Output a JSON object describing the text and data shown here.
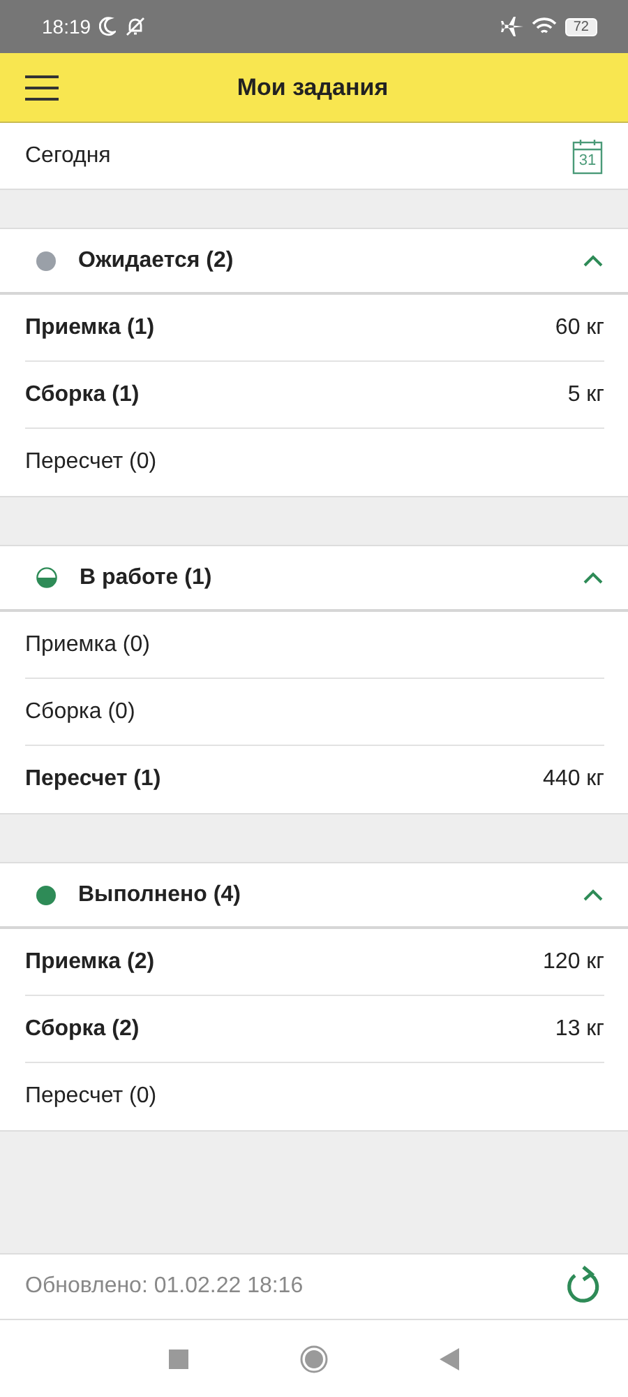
{
  "status_bar": {
    "time": "18:19",
    "battery": "72"
  },
  "header": {
    "title": "Мои задания"
  },
  "date_row": {
    "label": "Сегодня",
    "calendar_day": "31"
  },
  "sections": [
    {
      "title": "Ожидается (2)",
      "kind": "pending",
      "color": "#9aa0a8",
      "expanded": true,
      "rows": [
        {
          "label": "Приемка (1)",
          "value": "60 кг",
          "active": true
        },
        {
          "label": "Сборка (1)",
          "value": "5 кг",
          "active": true
        },
        {
          "label": "Пересчет (0)",
          "active": false
        }
      ]
    },
    {
      "title": "В работе (1)",
      "kind": "in_progress",
      "color": "#2e8b57",
      "expanded": true,
      "rows": [
        {
          "label": "Приемка (0)",
          "active": false
        },
        {
          "label": "Сборка (0)",
          "active": false
        },
        {
          "label": "Пересчет (1)",
          "value": "440 кг",
          "active": true
        }
      ]
    },
    {
      "title": "Выполнено (4)",
      "kind": "done",
      "color": "#2e8b57",
      "expanded": true,
      "rows": [
        {
          "label": "Приемка (2)",
          "value": "120 кг",
          "active": true
        },
        {
          "label": "Сборка (2)",
          "value": "13 кг",
          "active": true
        },
        {
          "label": "Пересчет (0)",
          "active": false
        }
      ]
    }
  ],
  "footer": {
    "updated": "Обновлено: 01.02.22 18:16"
  }
}
